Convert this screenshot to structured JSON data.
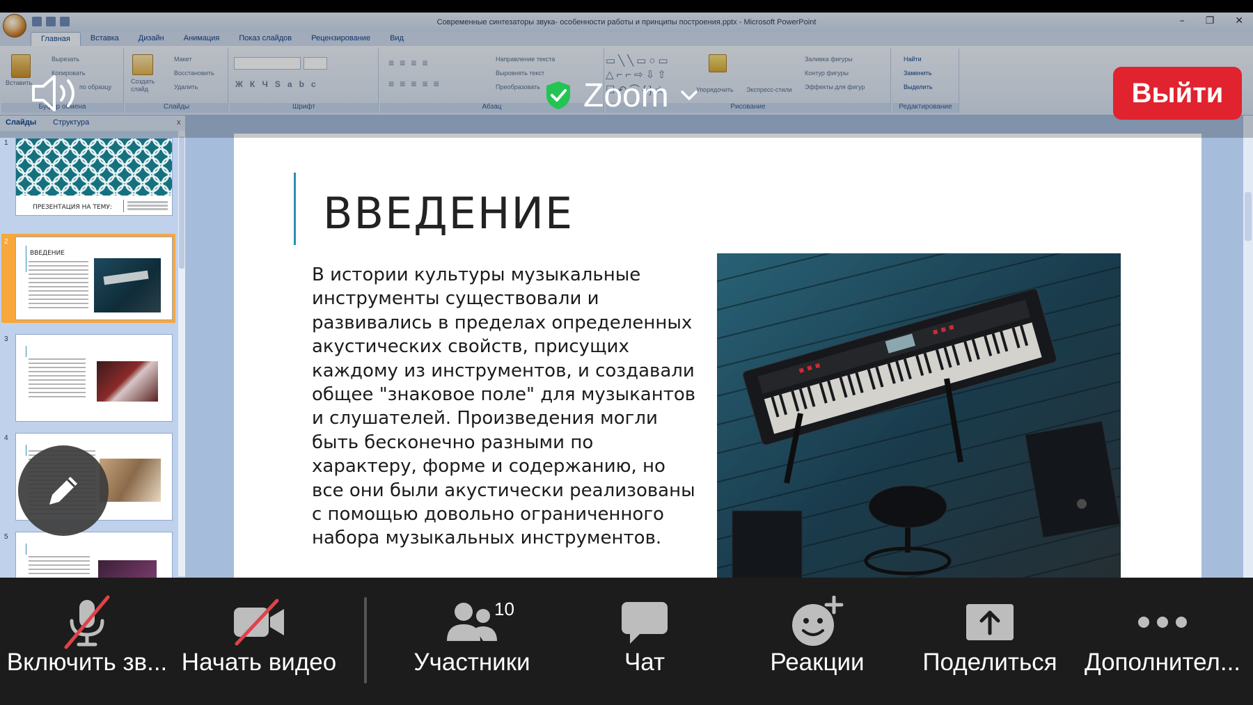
{
  "ppt": {
    "window_title": "Современные синтезаторы звука- особенности работы и принципы построения.pptx - Microsoft PowerPoint",
    "tabs": [
      "Главная",
      "Вставка",
      "Дизайн",
      "Анимация",
      "Показ слайдов",
      "Рецензирование",
      "Вид"
    ],
    "active_tab": "Главная",
    "ribbon": {
      "clipboard": {
        "paste": "Вставить",
        "cut": "Вырезать",
        "copy": "Копировать",
        "format": "по образцу",
        "group": "Буфер обмена"
      },
      "slides": {
        "new": "Создать слайд",
        "layout": "Макет",
        "reset": "Восстановить",
        "delete": "Удалить",
        "group": "Слайды"
      },
      "font": {
        "group": "Шрифт"
      },
      "paragraph": {
        "direction": "Направление текста",
        "align": "Выровнять текст",
        "convert": "Преобразовать",
        "group": "Абзац"
      },
      "drawing": {
        "arrange": "Упорядочить",
        "styles": "Экспресс-стили",
        "fill": "Заливка фигуры",
        "outline": "Контур фигуры",
        "effects": "Эффекты для фигур",
        "group": "Рисование"
      },
      "editing": {
        "find": "Найти",
        "replace": "Заменить",
        "select": "Выделить",
        "group": "Редактирование"
      }
    },
    "pane_tabs": {
      "slides": "Слайды",
      "outline": "Структура",
      "close": "x"
    },
    "thumbnails": [
      {
        "num": "1",
        "title": "ПРЕЗЕНТАЦИЯ  НА ТЕМУ:"
      },
      {
        "num": "2",
        "title": "ВВЕДЕНИЕ"
      },
      {
        "num": "3",
        "title": ""
      },
      {
        "num": "4",
        "title": ""
      },
      {
        "num": "5",
        "title": ""
      }
    ],
    "slide": {
      "title": "ВВЕДЕНИЕ",
      "body": "В истории культуры музыкальные инструменты существовали и развивались в пределах определенных акустических свойств, присущих каждому из инструментов, и создавали общее \"знаковое поле\" для музыкантов и слушателей. Произведения могли быть бесконечно разными по характеру, форме и содержанию, но все они были акустически реализованы с помощью довольно ограниченного набора музыкальных инструментов."
    }
  },
  "zoom": {
    "brand": "Zoom",
    "exit": "Выйти",
    "toolbar": [
      {
        "id": "audio",
        "label": "Включить зв...",
        "icon": "mic-off-icon"
      },
      {
        "id": "video",
        "label": "Начать видео",
        "icon": "video-off-icon"
      },
      {
        "id": "participants",
        "label": "Участники",
        "icon": "participants-icon",
        "count": "10"
      },
      {
        "id": "chat",
        "label": "Чат",
        "icon": "chat-icon"
      },
      {
        "id": "reactions",
        "label": "Реакции",
        "icon": "reaction-icon"
      },
      {
        "id": "share",
        "label": "Поделиться",
        "icon": "share-icon"
      },
      {
        "id": "more",
        "label": "Дополнител...",
        "icon": "more-icon"
      }
    ],
    "colors": {
      "exit": "#e0232e",
      "toolbar_bg": "#1c1c1c",
      "mute_slash": "#e0424a",
      "shield": "#23c552"
    }
  }
}
